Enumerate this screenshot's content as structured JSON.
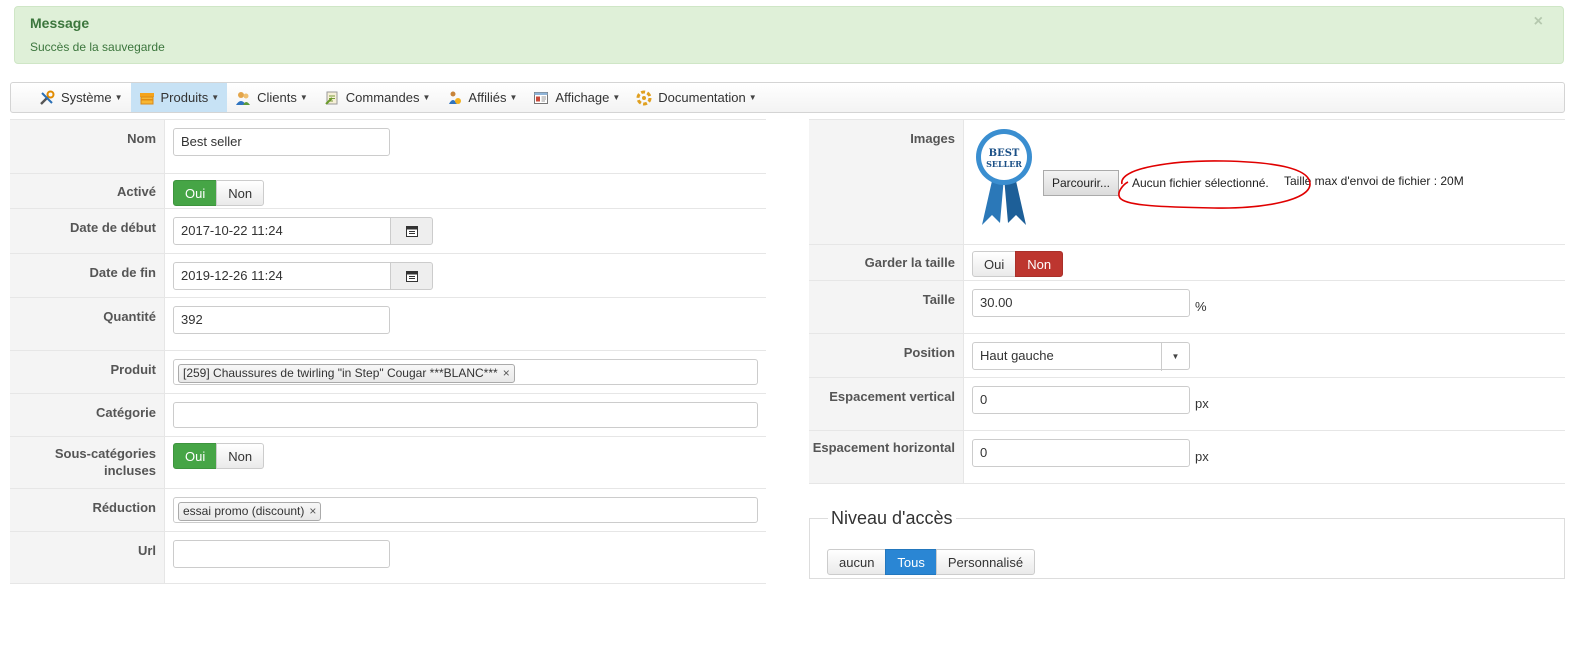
{
  "alert": {
    "title": "Message",
    "text": "Succès de la sauvegarde",
    "close": "×"
  },
  "menu": [
    {
      "label": "Système",
      "icon": "wrench-icon"
    },
    {
      "label": "Produits",
      "icon": "box-icon",
      "active": true
    },
    {
      "label": "Clients",
      "icon": "users-icon"
    },
    {
      "label": "Commandes",
      "icon": "orders-icon"
    },
    {
      "label": "Affiliés",
      "icon": "affiliates-icon"
    },
    {
      "label": "Affichage",
      "icon": "display-icon"
    },
    {
      "label": "Documentation",
      "icon": "help-icon"
    }
  ],
  "left": {
    "nom": {
      "label": "Nom",
      "value": "Best seller"
    },
    "active": {
      "label": "Activé",
      "yes": "Oui",
      "no": "Non",
      "selected": "Oui"
    },
    "start": {
      "label": "Date de début",
      "value": "2017-10-22 11:24"
    },
    "end": {
      "label": "Date de fin",
      "value": "2019-12-26 11:24"
    },
    "qty": {
      "label": "Quantité",
      "value": "392"
    },
    "product": {
      "label": "Produit",
      "tag": "[259] Chaussures de twirling \"in Step\" Cougar ***BLANC***",
      "remove": "×"
    },
    "category": {
      "label": "Catégorie",
      "value": ""
    },
    "subcats": {
      "label": "Sous-catégories incluses",
      "yes": "Oui",
      "no": "Non",
      "selected": "Oui"
    },
    "discount": {
      "label": "Réduction",
      "tag": "essai promo (discount)",
      "remove": "×"
    },
    "url": {
      "label": "Url",
      "value": ""
    }
  },
  "right": {
    "images": {
      "label": "Images",
      "medal_line1": "BEST",
      "medal_line2": "SELLER",
      "browse": "Parcourir...",
      "status": "Aucun fichier sélectionné.",
      "max": "Taille max d'envoi de fichier : 20M"
    },
    "keep_size": {
      "label": "Garder la taille",
      "yes": "Oui",
      "no": "Non",
      "selected": "Non"
    },
    "size": {
      "label": "Taille",
      "value": "30.00",
      "unit": "%"
    },
    "position": {
      "label": "Position",
      "value": "Haut gauche"
    },
    "vspace": {
      "label": "Espacement vertical",
      "value": "0",
      "unit": "px"
    },
    "hspace": {
      "label": "Espacement horizontal",
      "value": "0",
      "unit": "px"
    }
  },
  "access": {
    "legend": "Niveau d'accès",
    "options": [
      "aucun",
      "Tous",
      "Personnalisé"
    ],
    "selected": "Tous"
  },
  "colors": {
    "success_bg": "#dff0d8",
    "green": "#46a546",
    "red": "#bd362f",
    "blue": "#2a86d4",
    "annotation": "#e00000"
  }
}
